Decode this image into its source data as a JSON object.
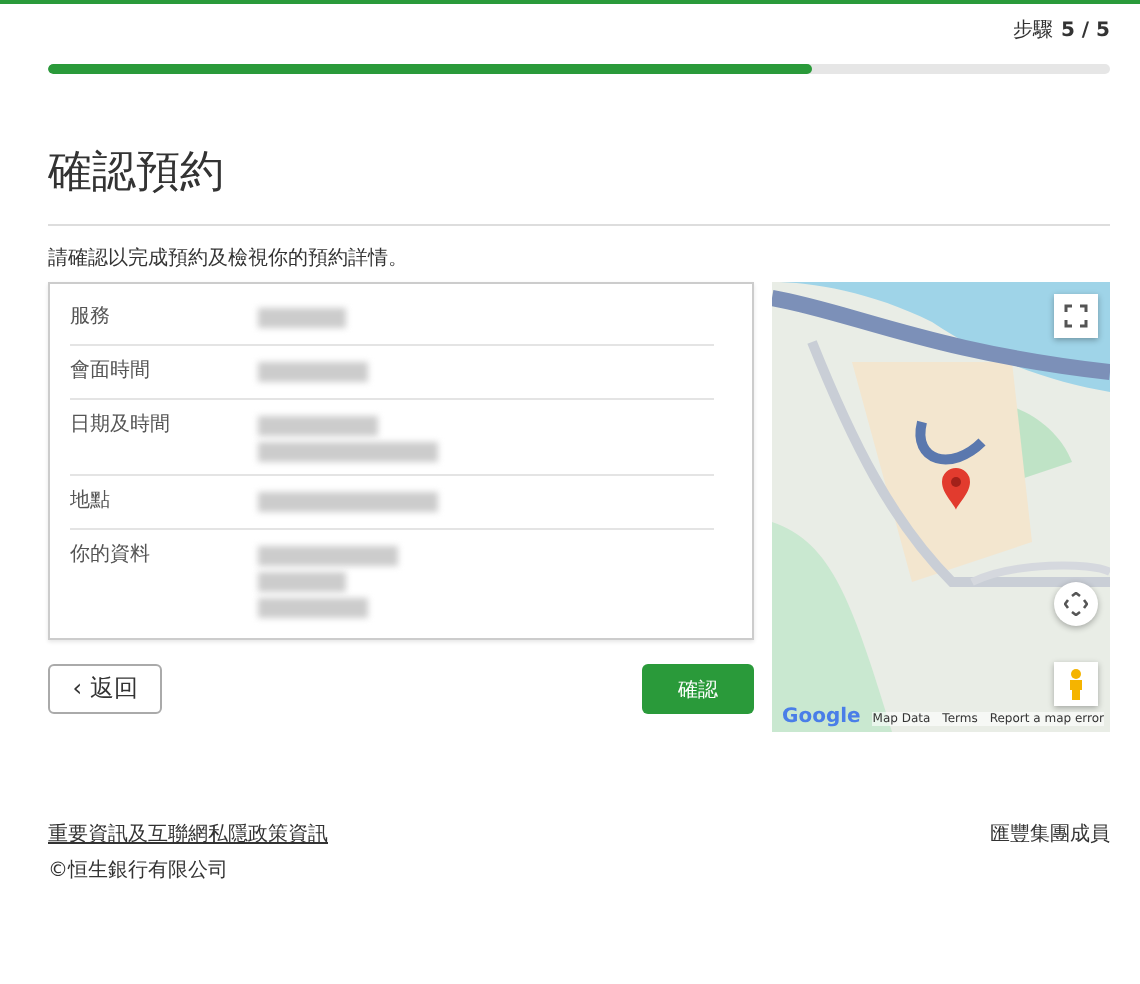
{
  "step": {
    "label": "步驟",
    "value": "5 / 5"
  },
  "progress": {
    "level": 0.72
  },
  "title": "確認預約",
  "instruction": "請確認以完成預約及檢視你的預約詳情。",
  "details": [
    {
      "label": "服務"
    },
    {
      "label": "會面時間"
    },
    {
      "label": "日期及時間"
    },
    {
      "label": "地點"
    },
    {
      "label": "你的資料"
    }
  ],
  "buttons": {
    "back": "‹ 返回",
    "confirm": "確認"
  },
  "map": {
    "logo": "Google",
    "attribution": [
      "Map Data",
      "Terms",
      "Report a map error"
    ]
  },
  "footer": {
    "link": "重要資訊及互聯網私隱政策資訊",
    "copyright": "©恒生銀行有限公司",
    "member": "匯豐集團成員"
  }
}
